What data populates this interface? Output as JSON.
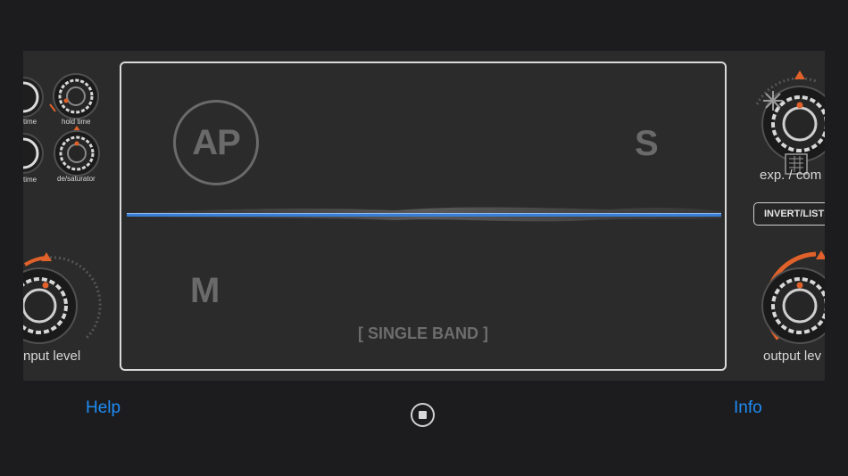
{
  "plugin": {
    "left_panel": {
      "knob_labels": {
        "attack_time_partial": "time",
        "hold_time": "hold time",
        "release_time_partial": "time",
        "desaturator": "de/saturator",
        "input_level_partial": "nput level"
      }
    },
    "display": {
      "badge": "AP",
      "side_label": "S",
      "mid_label": "M",
      "mode": "[ SINGLE BAND ]"
    },
    "right_panel": {
      "expander_label_partial": "exp. / com",
      "invert_button_partial": "INVERT/LISTE",
      "output_level_partial": "output lev"
    },
    "colors": {
      "accent": "#e0622a",
      "trace": "#3a7fd4",
      "frame": "#d9d9d9"
    }
  },
  "bottom_bar": {
    "help_label": "Help",
    "info_label": "Info",
    "stop_icon": "stop-icon"
  }
}
